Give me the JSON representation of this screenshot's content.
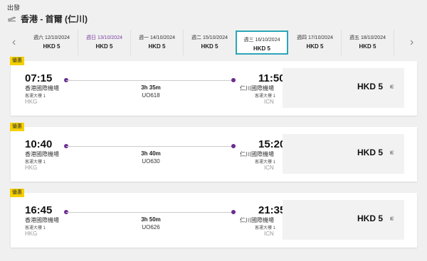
{
  "header": {
    "label": "出發",
    "route": "香港 - 首爾 (仁川)"
  },
  "dates": [
    {
      "date": "週六 12/10/2024",
      "price": "HKD  5"
    },
    {
      "date": "週日 13/10/2024",
      "price": "HKD  5"
    },
    {
      "date": "週一 14/10/2024",
      "price": "HKD  5"
    },
    {
      "date": "週二 15/10/2024",
      "price": "HKD  5"
    },
    {
      "date": "週三 16/10/2024",
      "price": "HKD  5"
    },
    {
      "date": "週四 17/10/2024",
      "price": "HKD  5"
    },
    {
      "date": "週五 18/10/2024",
      "price": "HKD  5"
    }
  ],
  "flights": [
    {
      "badge": "優惠",
      "dep_time": "07:15",
      "arr_time": "11:50",
      "dep_airport": "香港國際機場",
      "arr_airport": "仁川國際機場",
      "dep_terminal": "客運大樓 1",
      "arr_terminal": "客運大樓 1",
      "dep_code": "HKG",
      "arr_code": "ICN",
      "duration": "3h 35m",
      "flight_no": "UO618",
      "price": "HKD  5",
      "price_suffix": "起"
    },
    {
      "badge": "優惠",
      "dep_time": "10:40",
      "arr_time": "15:20",
      "dep_airport": "香港國際機場",
      "arr_airport": "仁川國際機場",
      "dep_terminal": "客運大樓 1",
      "arr_terminal": "客運大樓 1",
      "dep_code": "HKG",
      "arr_code": "ICN",
      "duration": "3h 40m",
      "flight_no": "UO630",
      "price": "HKD  5",
      "price_suffix": "起"
    },
    {
      "badge": "優惠",
      "dep_time": "16:45",
      "arr_time": "21:35",
      "dep_airport": "香港國際機場",
      "arr_airport": "仁川國際機場",
      "dep_terminal": "客運大樓 1",
      "arr_terminal": "客運大樓 1",
      "dep_code": "HKG",
      "arr_code": "ICN",
      "duration": "3h 50m",
      "flight_no": "UO626",
      "price": "HKD  5",
      "price_suffix": "起"
    }
  ],
  "colors": {
    "accent_purple": "#6a2c91",
    "selected_border": "#2aa6b8",
    "badge_yellow": "#f5d000"
  }
}
